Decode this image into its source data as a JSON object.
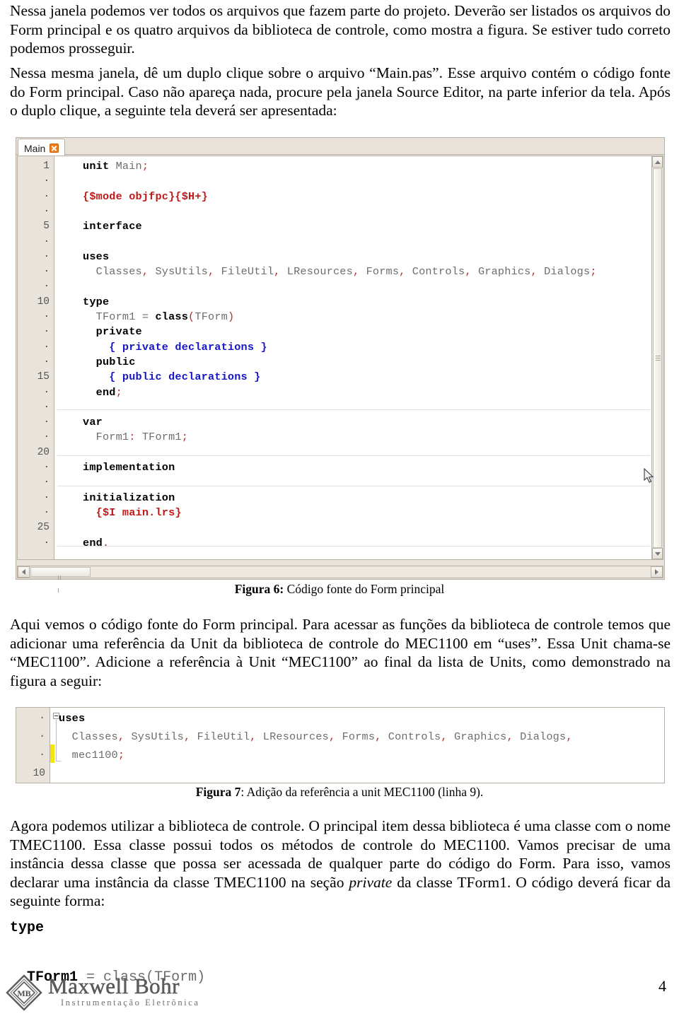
{
  "document": {
    "page_number": "4",
    "paragraphs": {
      "p1": "Nessa janela podemos ver todos os arquivos que fazem parte do projeto. Deverão ser listados os arquivos do Form principal e os quatro arquivos da biblioteca de controle, como mostra a figura. Se estiver tudo correto podemos prosseguir.",
      "p2": "Nessa mesma janela, dê um duplo clique sobre o arquivo “Main.pas”. Esse arquivo contém o código fonte do Form principal. Caso não apareça nada, procure pela janela Source Editor, na parte inferior da tela. Após o duplo clique, a seguinte tela deverá ser apresentada:",
      "p3_pre": "Aqui vemos o código fonte do Form principal. Para acessar as funções da biblioteca de controle temos que adicionar uma referência da Unit da biblioteca de controle do MEC1100 em “uses”. Essa Unit chama-se “MEC1100”. Adicione a referência à Unit “MEC1100” ao final da lista de Units, como demonstrado na figura a seguir:",
      "p4_a": "Agora podemos utilizar a biblioteca de controle. O principal item dessa biblioteca é uma classe com o nome TMEC1100. Essa classe possui todos os métodos de controle do MEC1100. Vamos precisar de uma instância dessa classe que possa ser acessada de qualquer parte do código do Form. Para isso, vamos declarar uma instância da classe TMEC1100 na seção ",
      "p4_em": "private",
      "p4_b": " da classe TForm1. O código deverá ficar da seguinte forma:"
    },
    "captions": {
      "fig6_label": "Figura 6:",
      "fig6_text": " Código fonte do Form principal",
      "fig7_label": "Figura 7",
      "fig7_text": ": Adição da referência a unit MEC1100 (linha 9)."
    },
    "footer": {
      "logo_name": "Maxwell Bohr",
      "logo_sub": "Instrumentação Eletrônica",
      "logo_monogram": "MB"
    }
  },
  "editor": {
    "tab_label": "Main",
    "close_icon": "close-icon",
    "gutter_numbers": [
      "1",
      "·",
      "·",
      "·",
      "5",
      "·",
      "·",
      "·",
      "·",
      "10",
      "·",
      "·",
      "·",
      "·",
      "15",
      "·",
      "·",
      "·",
      "·",
      "20",
      "·",
      "·",
      "·",
      "·",
      "25",
      "·"
    ],
    "code_lines": [
      {
        "n": 1,
        "tokens": [
          {
            "t": "unit",
            "c": "kw"
          },
          {
            "t": " ",
            "c": "id"
          },
          {
            "t": "Main",
            "c": "id"
          },
          {
            "t": ";",
            "c": "pun"
          }
        ]
      },
      {
        "n": 2,
        "tokens": []
      },
      {
        "n": 3,
        "tokens": [
          {
            "t": "{$mode objfpc}{$H+}",
            "c": "dir"
          }
        ]
      },
      {
        "n": 4,
        "tokens": []
      },
      {
        "n": 5,
        "tokens": [
          {
            "t": "interface",
            "c": "kw"
          }
        ]
      },
      {
        "n": 6,
        "tokens": []
      },
      {
        "n": 7,
        "tokens": [
          {
            "t": "uses",
            "c": "kw"
          }
        ]
      },
      {
        "n": 8,
        "tokens": [
          {
            "t": "  Classes",
            "c": "id"
          },
          {
            "t": ",",
            "c": "pun"
          },
          {
            "t": " SysUtils",
            "c": "id"
          },
          {
            "t": ",",
            "c": "pun"
          },
          {
            "t": " FileUtil",
            "c": "id"
          },
          {
            "t": ",",
            "c": "pun"
          },
          {
            "t": " LResources",
            "c": "id"
          },
          {
            "t": ",",
            "c": "pun"
          },
          {
            "t": " Forms",
            "c": "id"
          },
          {
            "t": ",",
            "c": "pun"
          },
          {
            "t": " Controls",
            "c": "id"
          },
          {
            "t": ",",
            "c": "pun"
          },
          {
            "t": " Graphics",
            "c": "id"
          },
          {
            "t": ",",
            "c": "pun"
          },
          {
            "t": " Dialogs",
            "c": "id"
          },
          {
            "t": ";",
            "c": "pun"
          }
        ]
      },
      {
        "n": 9,
        "tokens": []
      },
      {
        "n": 10,
        "tokens": [
          {
            "t": "type",
            "c": "kw"
          }
        ]
      },
      {
        "n": 11,
        "tokens": [
          {
            "t": "  TForm1",
            "c": "id"
          },
          {
            "t": " = ",
            "c": "op"
          },
          {
            "t": "class",
            "c": "kw"
          },
          {
            "t": "(",
            "c": "pun"
          },
          {
            "t": "TForm",
            "c": "id"
          },
          {
            "t": ")",
            "c": "pun"
          }
        ]
      },
      {
        "n": 12,
        "tokens": [
          {
            "t": "  private",
            "c": "kw"
          }
        ]
      },
      {
        "n": 13,
        "tokens": [
          {
            "t": "    { private declarations }",
            "c": "cmt"
          }
        ]
      },
      {
        "n": 14,
        "tokens": [
          {
            "t": "  public",
            "c": "kw"
          }
        ]
      },
      {
        "n": 15,
        "tokens": [
          {
            "t": "    { public declarations }",
            "c": "cmt"
          }
        ]
      },
      {
        "n": 16,
        "tokens": [
          {
            "t": "  end",
            "c": "kw"
          },
          {
            "t": ";",
            "c": "pun"
          }
        ]
      },
      {
        "n": 17,
        "tokens": []
      },
      {
        "n": 18,
        "tokens": [
          {
            "t": "var",
            "c": "kw"
          }
        ]
      },
      {
        "n": 19,
        "tokens": [
          {
            "t": "  Form1",
            "c": "id"
          },
          {
            "t": ":",
            "c": "pun"
          },
          {
            "t": " TForm1",
            "c": "id"
          },
          {
            "t": ";",
            "c": "pun"
          }
        ]
      },
      {
        "n": 20,
        "tokens": []
      },
      {
        "n": 21,
        "tokens": [
          {
            "t": "implementation",
            "c": "kw"
          }
        ]
      },
      {
        "n": 22,
        "tokens": []
      },
      {
        "n": 23,
        "tokens": [
          {
            "t": "initialization",
            "c": "kw"
          }
        ]
      },
      {
        "n": 24,
        "tokens": [
          {
            "t": "  {$I main.lrs}",
            "c": "dir"
          }
        ]
      },
      {
        "n": 25,
        "tokens": []
      },
      {
        "n": 26,
        "tokens": [
          {
            "t": "end",
            "c": "kw"
          },
          {
            "t": ".",
            "c": "pun"
          }
        ]
      }
    ],
    "scrollbar": {
      "up_icon": "scroll-up-arrow-icon",
      "down_icon": "scroll-down-arrow-icon",
      "left_icon": "scroll-left-arrow-icon",
      "right_icon": "scroll-right-arrow-icon",
      "grip_icon": "scrollbar-grip-icon"
    },
    "cursor_icon": "mouse-pointer-icon"
  },
  "snippet": {
    "gutter_numbers": [
      "·",
      "·",
      "·",
      "10",
      "·"
    ],
    "lines": [
      {
        "tokens": [
          {
            "t": "uses",
            "c": "kw"
          }
        ]
      },
      {
        "tokens": [
          {
            "t": "  Classes",
            "c": "id"
          },
          {
            "t": ",",
            "c": "pun"
          },
          {
            "t": " SysUtils",
            "c": "id"
          },
          {
            "t": ",",
            "c": "pun"
          },
          {
            "t": " FileUtil",
            "c": "id"
          },
          {
            "t": ",",
            "c": "pun"
          },
          {
            "t": " LResources",
            "c": "id"
          },
          {
            "t": ",",
            "c": "pun"
          },
          {
            "t": " Forms",
            "c": "id"
          },
          {
            "t": ",",
            "c": "pun"
          },
          {
            "t": " Controls",
            "c": "id"
          },
          {
            "t": ",",
            "c": "pun"
          },
          {
            "t": " Graphics",
            "c": "id"
          },
          {
            "t": ",",
            "c": "pun"
          },
          {
            "t": " Dialogs",
            "c": "id"
          },
          {
            "t": ",",
            "c": "pun"
          }
        ]
      },
      {
        "tokens": [
          {
            "t": "  mec1100",
            "c": "id"
          },
          {
            "t": ";",
            "c": "pun"
          }
        ]
      },
      {
        "tokens": []
      },
      {
        "tokens": []
      }
    ]
  },
  "final_code": {
    "lines": [
      {
        "tokens": [
          {
            "t": "type",
            "c": "kw"
          }
        ]
      },
      {
        "tokens": []
      },
      {
        "tokens": [
          {
            "t": "  TForm1",
            "c": "kw"
          },
          {
            "t": " = ",
            "c": "op"
          },
          {
            "t": "class",
            "c": "id"
          },
          {
            "t": "(",
            "c": "id"
          },
          {
            "t": "TForm",
            "c": "id"
          },
          {
            "t": ")",
            "c": "id"
          }
        ]
      }
    ]
  },
  "colors": {
    "keyword": "#000000",
    "identifier": "#6d6d6d",
    "directive": "#c01818",
    "comment": "#1616c8",
    "punctuation": "#b03030",
    "tab_close": "#f07f1a",
    "modified_marker": "#f5e60a",
    "chrome": "#e8e2da"
  }
}
